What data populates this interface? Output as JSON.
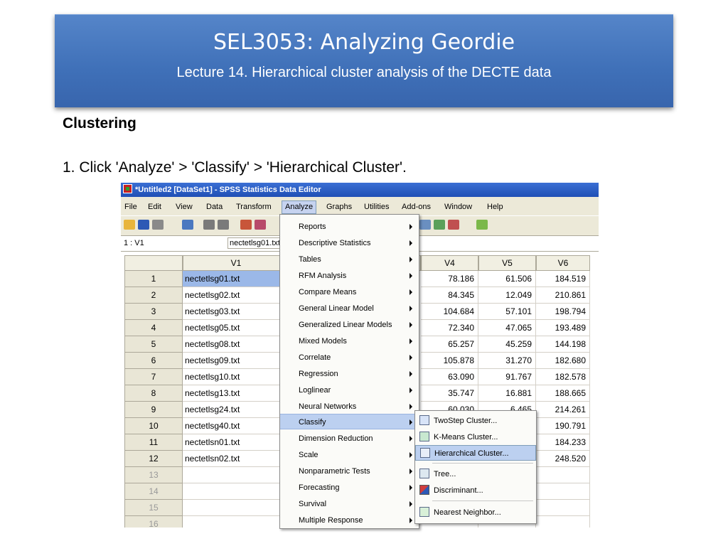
{
  "slide": {
    "title": "SEL3053: Analyzing Geordie",
    "subtitle": "Lecture 14. Hierarchical cluster analysis of the DECTE data",
    "heading": "Clustering",
    "step": "1. Click 'Analyze' > 'Classify' > 'Hierarchical Cluster'."
  },
  "window": {
    "title": "*Untitled2 [DataSet1] - SPSS Statistics Data Editor",
    "menus": [
      "File",
      "Edit",
      "View",
      "Data",
      "Transform",
      "Analyze",
      "Graphs",
      "Utilities",
      "Add-ons",
      "Window",
      "Help"
    ],
    "active_menu": "Analyze",
    "cell_ref": "1 : V1",
    "cell_value": "nectetlsg01.txt",
    "columns": [
      "V1",
      "V4",
      "V5",
      "V6"
    ],
    "rows": [
      {
        "n": "1",
        "v1": "nectetlsg01.txt",
        "v4": "78.186",
        "v5": "61.506",
        "v6": "184.519"
      },
      {
        "n": "2",
        "v1": "nectetlsg02.txt",
        "v4": "84.345",
        "v5": "12.049",
        "v6": "210.861"
      },
      {
        "n": "3",
        "v1": "nectetlsg03.txt",
        "v4": "104.684",
        "v5": "57.101",
        "v6": "198.794"
      },
      {
        "n": "4",
        "v1": "nectetlsg05.txt",
        "v4": "72.340",
        "v5": "47.065",
        "v6": "193.489"
      },
      {
        "n": "5",
        "v1": "nectetlsg08.txt",
        "v4": "65.257",
        "v5": "45.259",
        "v6": "144.198"
      },
      {
        "n": "6",
        "v1": "nectetlsg09.txt",
        "v4": "105.878",
        "v5": "31.270",
        "v6": "182.680"
      },
      {
        "n": "7",
        "v1": "nectetlsg10.txt",
        "v4": "63.090",
        "v5": "91.767",
        "v6": "182.578"
      },
      {
        "n": "8",
        "v1": "nectetlsg13.txt",
        "v4": "35.747",
        "v5": "16.881",
        "v6": "188.665"
      },
      {
        "n": "9",
        "v1": "nectetlsg24.txt",
        "v4": "60.030",
        "v5": "6.465",
        "v6": "214.261"
      },
      {
        "n": "10",
        "v1": "nectetlsg40.txt",
        "v4": "",
        "v5": "",
        "v6": "190.791"
      },
      {
        "n": "11",
        "v1": "nectetlsn01.txt",
        "v4": "",
        "v5": "",
        "v6": "184.233"
      },
      {
        "n": "12",
        "v1": "nectetlsn02.txt",
        "v4": "",
        "v5": "",
        "v6": "248.520"
      },
      {
        "n": "13",
        "v1": "",
        "v4": "",
        "v5": "",
        "v6": ""
      },
      {
        "n": "14",
        "v1": "",
        "v4": "",
        "v5": "",
        "v6": ""
      },
      {
        "n": "15",
        "v1": "",
        "v4": "",
        "v5": "",
        "v6": ""
      },
      {
        "n": "16",
        "v1": "",
        "v4": "",
        "v5": "",
        "v6": ""
      }
    ]
  },
  "analyze_menu": [
    "Reports",
    "Descriptive Statistics",
    "Tables",
    "RFM Analysis",
    "Compare Means",
    "General Linear Model",
    "Generalized Linear Models",
    "Mixed Models",
    "Correlate",
    "Regression",
    "Loglinear",
    "Neural Networks",
    "Classify",
    "Dimension Reduction",
    "Scale",
    "Nonparametric Tests",
    "Forecasting",
    "Survival",
    "Multiple Response"
  ],
  "highlighted_item": "Classify",
  "classify_submenu": [
    {
      "label": "TwoStep Cluster...",
      "icon": "twostep-cluster-icon"
    },
    {
      "label": "K-Means Cluster...",
      "icon": "kmeans-cluster-icon"
    },
    {
      "label": "Hierarchical Cluster...",
      "icon": "hierarchical-cluster-icon"
    },
    {
      "label": "Tree...",
      "icon": "tree-icon"
    },
    {
      "label": "Discriminant...",
      "icon": "discriminant-icon"
    },
    {
      "label": "Nearest Neighbor...",
      "icon": "nearest-neighbor-icon"
    }
  ],
  "highlighted_subitem": "Hierarchical Cluster...",
  "colors": {
    "banner": "#3f70b8",
    "title_bar": "#2456c4",
    "menu_highlight": "#bcd0f0",
    "selected_cell": "#9bb8e8"
  }
}
